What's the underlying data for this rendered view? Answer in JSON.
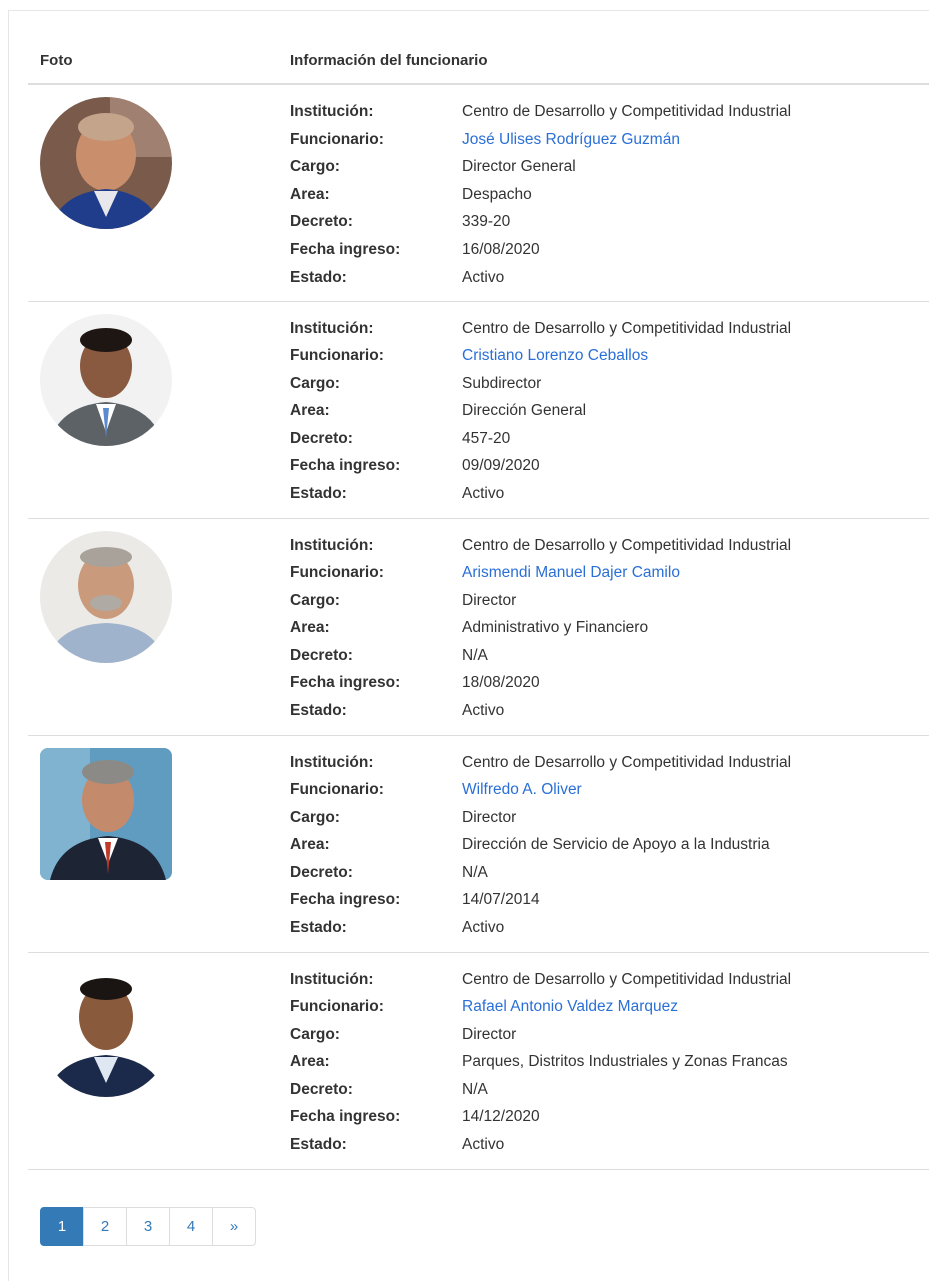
{
  "table": {
    "headers": {
      "photo": "Foto",
      "info": "Información del funcionario"
    },
    "labels": {
      "institucion": "Institución:",
      "funcionario": "Funcionario:",
      "cargo": "Cargo:",
      "area": "Area:",
      "decreto": "Decreto:",
      "fecha": "Fecha ingreso:",
      "estado": "Estado:"
    },
    "rows": [
      {
        "institucion": "Centro de Desarrollo y Competitividad Industrial",
        "funcionario": "José Ulises Rodríguez Guzmán",
        "cargo": "Director General",
        "area": "Despacho",
        "decreto": "339-20",
        "fecha": "16/08/2020",
        "estado": "Activo"
      },
      {
        "institucion": "Centro de Desarrollo y Competitividad Industrial",
        "funcionario": "Cristiano Lorenzo Ceballos",
        "cargo": "Subdirector",
        "area": "Dirección General",
        "decreto": "457-20",
        "fecha": "09/09/2020",
        "estado": "Activo"
      },
      {
        "institucion": "Centro de Desarrollo y Competitividad Industrial",
        "funcionario": "Arismendi Manuel Dajer Camilo",
        "cargo": "Director",
        "area": "Administrativo y Financiero",
        "decreto": "N/A",
        "fecha": "18/08/2020",
        "estado": "Activo"
      },
      {
        "institucion": "Centro de Desarrollo y Competitividad Industrial",
        "funcionario": "Wilfredo A. Oliver",
        "cargo": "Director",
        "area": "Dirección de Servicio de Apoyo a la Industria",
        "decreto": "N/A",
        "fecha": "14/07/2014",
        "estado": "Activo"
      },
      {
        "institucion": "Centro de Desarrollo y Competitividad Industrial",
        "funcionario": "Rafael Antonio Valdez Marquez",
        "cargo": "Director",
        "area": "Parques, Distritos Industriales y Zonas Francas",
        "decreto": "N/A",
        "fecha": "14/12/2020",
        "estado": "Activo"
      }
    ]
  },
  "pagination": {
    "pages": [
      "1",
      "2",
      "3",
      "4"
    ],
    "next": "»",
    "active": "1"
  },
  "colors": {
    "link": "#2a6fd6",
    "accent": "#337ab7"
  }
}
